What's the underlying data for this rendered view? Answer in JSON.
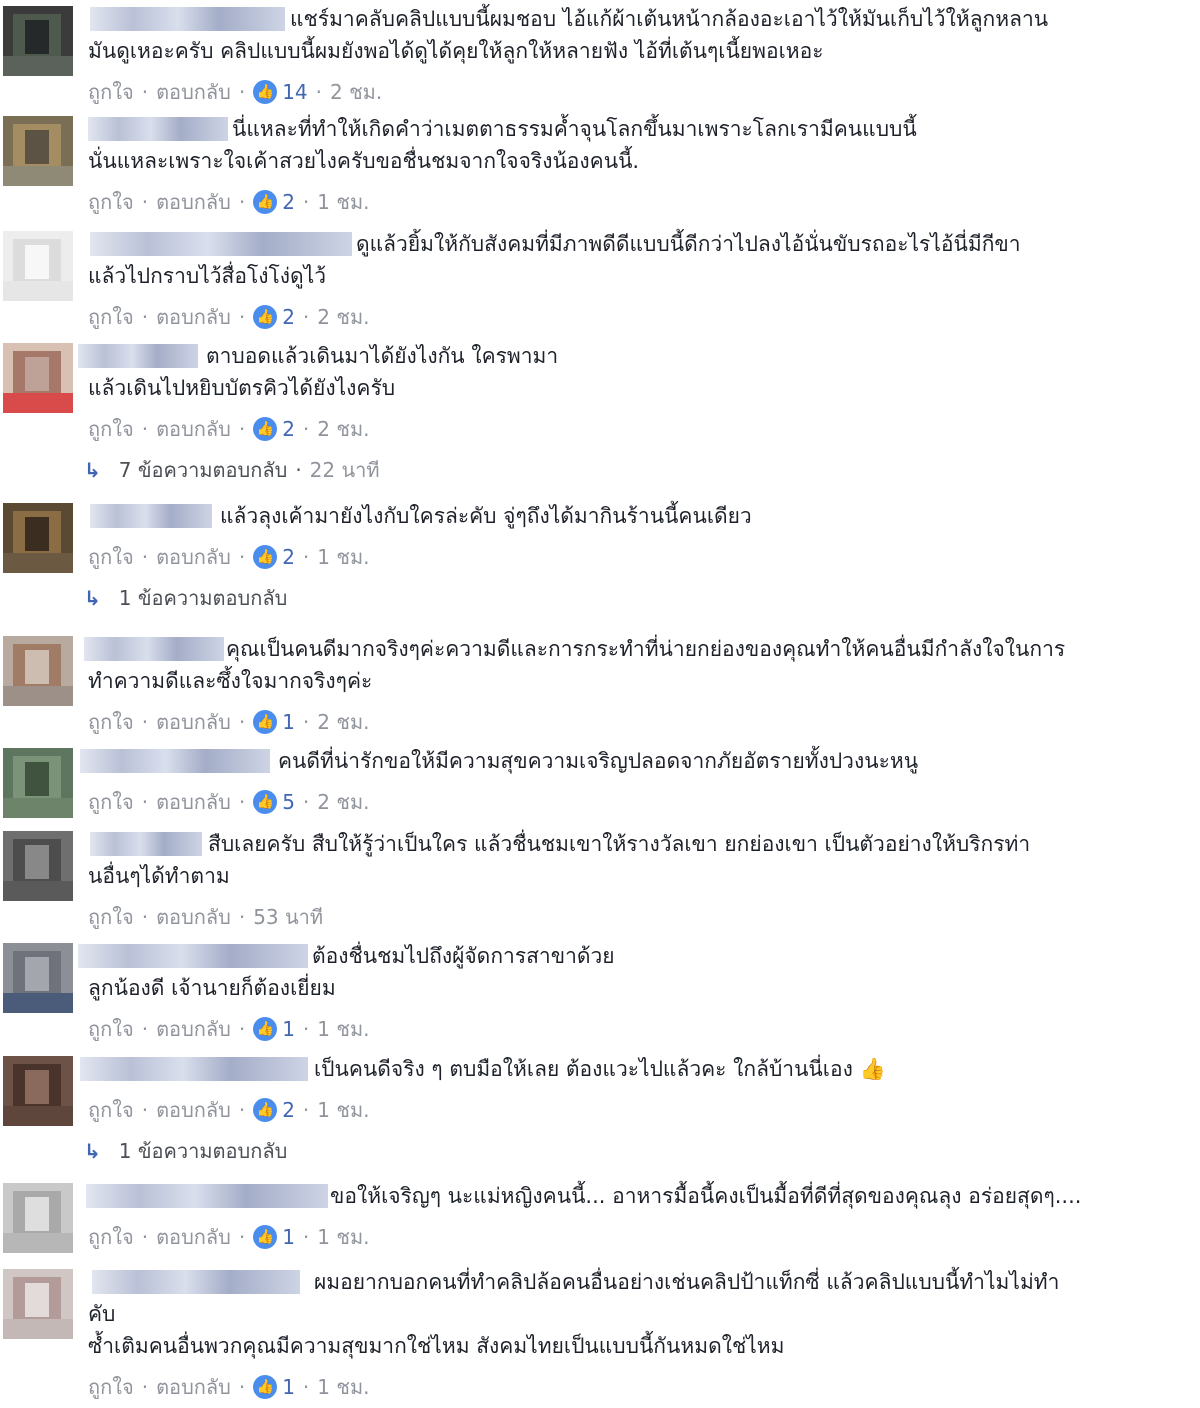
{
  "colors": {
    "text": "#1d2129",
    "meta": "#90949c",
    "link": "#4267b2",
    "like_badge": "#4a8ded",
    "name_blur": "#b2bad2"
  },
  "icons": {
    "like_badge": "thumbs-up-icon",
    "reply_arrow": "reply-arrow-icon"
  },
  "actions": {
    "like_label": "ถูกใจ",
    "reply_label": "ตอบกลับ",
    "separator": "·"
  },
  "comments": [
    {
      "avatar": [
        "#3b3b3b",
        "#4f5a4f",
        "#25292a",
        "#5b625c"
      ],
      "lines": [
        "แชร์มาคลับคลิปแบบนี้ผมชอบ ไอ้แก้ผ้าเต้นหน้ากล้องอะเอาไว้ให้มันเก็บไว้ให้ลูกหลาน",
        "มันดูเหอะครับ คลิปแบบนี้ผมยังพอได้ดูได้คุยให้ลูกให้หลายฟัง ไอ้ที่เต้นๆเนี้ยพอเหอะ"
      ],
      "likes": "14",
      "time": "2 ชม."
    },
    {
      "avatar": [
        "#7a6e55",
        "#a48d63",
        "#5c5344",
        "#8f8a76"
      ],
      "lines": [
        "นี่แหละที่ทำให้เกิดคำว่าเมตตาธรรมค้ำจุนโลกขึ้นมาเพราะโลกเรามีคนแบบนี้",
        "นั่นแหละเพราะใจเค้าสวยไงครับขอชื่นชมจากใจจริงน้องคนนี้."
      ],
      "likes": "2",
      "time": "1 ชม."
    },
    {
      "avatar": [
        "#ededed",
        "#dcdcdc",
        "#f7f7f7",
        "#e6e6e6"
      ],
      "lines": [
        "ดูแล้วยิ้มให้กับสังคมที่มีภาพดีดีแบบนี้ดีกว่าไปลงไอ้นั่นขับรถอะไรไอ้นี่มีกีขา",
        "แล้วไปกราบไว้สื่อโง่โง่ดูไว้"
      ],
      "likes": "2",
      "time": "2 ชม."
    },
    {
      "avatar": [
        "#d8c1b3",
        "#a5786a",
        "#bfa297",
        "#d94a4a"
      ],
      "lines": [
        "ตาบอดแล้วเดินมาได้ยังไงกัน ใครพามา",
        "แล้วเดินไปหยิบบัตรคิวได้ยังไงครับ"
      ],
      "likes": "2",
      "time": "2 ชม.",
      "replies": {
        "label": "7 ข้อความตอบกลับ",
        "time": "22 นาที"
      }
    },
    {
      "avatar": [
        "#5a4a33",
        "#8a6d45",
        "#3b2e20",
        "#6b5a41"
      ],
      "lines": [
        "แล้วลุงเค้ามายังไงกับใครล่ะคับ จู่ๆถึงได้มากินร้านนี้คนเดียว"
      ],
      "likes": "2",
      "time": "1 ชม.",
      "replies": {
        "label": "1 ข้อความตอบกลับ"
      }
    },
    {
      "avatar": [
        "#b9aaa0",
        "#a07b65",
        "#cdbdb0",
        "#9c9088"
      ],
      "lines": [
        "คุณเป็นคนดีมากจริงๆค่ะความดีและการกระทำที่น่ายกย่องของคุณทำให้คนอื่นมีกำลังใจในการ",
        "ทำความดีและซึ้งใจมากจริงๆค่ะ"
      ],
      "likes": "1",
      "time": "2 ชม."
    },
    {
      "avatar": [
        "#5e7560",
        "#7b9378",
        "#40533f",
        "#6d836a"
      ],
      "lines": [
        "คนดีที่น่ารักขอให้มีความสุขความเจริญปลอดจากภัยอัตรายทั้งปวงนะหนู"
      ],
      "likes": "5",
      "time": "2 ชม."
    },
    {
      "avatar": [
        "#6f6f6f",
        "#4d4d4d",
        "#888888",
        "#5a5a5a"
      ],
      "lines": [
        "สืบเลยครับ สืบให้รู้ว่าเป็นใคร แล้วชื่นชมเขาให้รางวัลเขา ยกย่องเขา เป็นตัวอย่างให้บริกรท่า",
        "นอื่นๆได้ทำตาม"
      ],
      "time": "53 นาที"
    },
    {
      "avatar": [
        "#8d8f96",
        "#6f727a",
        "#a3a6ad",
        "#4b5b7a"
      ],
      "lines": [
        "ต้องชื่นชมไปถึงผู้จัดการสาขาด้วย",
        "ลูกน้องดี เจ้านายก็ต้องเยี่ยม"
      ],
      "likes": "1",
      "time": "1 ชม."
    },
    {
      "avatar": [
        "#6d5248",
        "#4a332b",
        "#8a6a5d",
        "#5e463d"
      ],
      "lines": [
        "เป็นคนดีจริง ๆ ตบมือให้เลย ต้องแวะไปแล้วคะ ใกล้บ้านนี่เอง 👍"
      ],
      "likes": "2",
      "time": "1 ชม.",
      "replies": {
        "label": "1 ข้อความตอบกลับ"
      }
    },
    {
      "avatar": [
        "#c9c9c9",
        "#a9a9a9",
        "#dedede",
        "#b7b7b7"
      ],
      "lines": [
        "ขอให้เจริญๆ นะแม่หญิงคนนี้... อาหารมื้อนี้คงเป็นมื้อที่ดีที่สุดของคุณลุง อร่อยสุดๆ...."
      ],
      "likes": "1",
      "time": "1 ชม."
    },
    {
      "avatar": [
        "#d0c7c5",
        "#b39b9a",
        "#e2dbda",
        "#c4b8b7"
      ],
      "lines": [
        "ผมอยากบอกคนที่ทำคลิปล้อคนอื่นอย่างเช่นคลิปป้าแท็กซี่ แล้วคลิปแบบนี้ทำไมไม่ทำ",
        "คับ",
        "ซ้ำเติมคนอื่นพวกคุณมีความสุขมากใช่ไหม สังคมไทยเป็นแบบนี้กันหมดใช่ไหม"
      ],
      "likes": "1",
      "time": "1 ชม."
    }
  ]
}
